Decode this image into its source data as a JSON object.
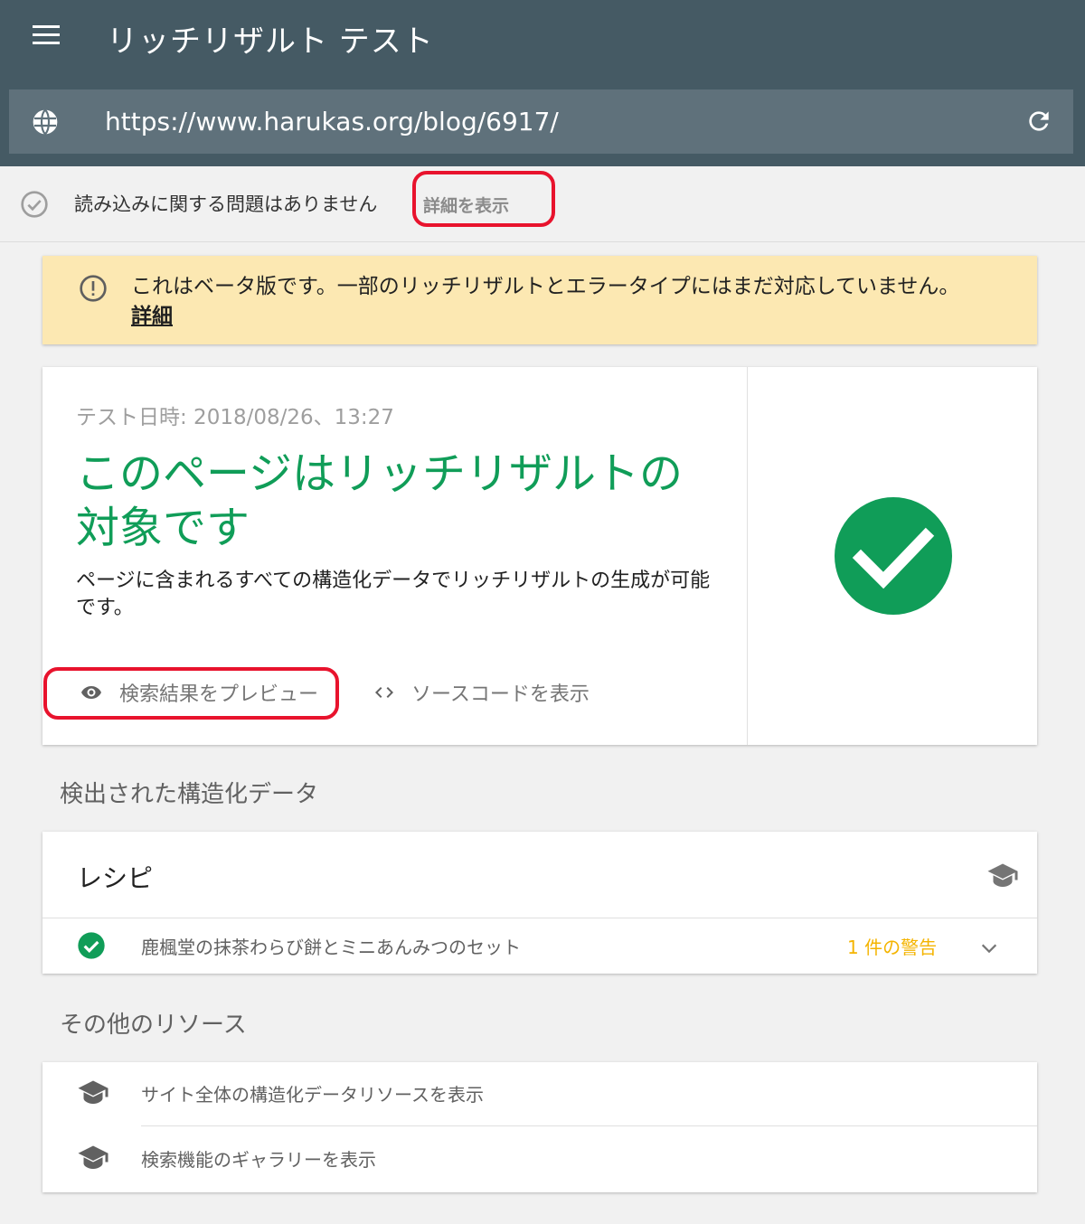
{
  "header": {
    "title": "リッチリザルト テスト",
    "menu_icon": "menu-icon"
  },
  "urlbar": {
    "url": "https://www.harukas.org/blog/6917/",
    "left_icon": "globe-icon",
    "right_icon": "reload-icon"
  },
  "status": {
    "text": "読み込みに関する問題はありません",
    "details_label": "詳細を表示"
  },
  "beta_notice": {
    "text": "これはベータ版です。一部のリッチリザルトとエラータイプにはまだ対応していません。",
    "link_label": "詳細"
  },
  "result": {
    "test_date": "テスト日時: 2018/08/26、13:27",
    "headline": "このページはリッチリザルトの対象です",
    "description": "ページに含まれるすべての構造化データでリッチリザルトの生成が可能です。",
    "preview_label": "検索結果をプレビュー",
    "source_label": "ソースコードを表示"
  },
  "detected": {
    "section_title": "検出された構造化データ",
    "card_title": "レシピ",
    "item_text": "鹿楓堂の抹茶わらび餅とミニあんみつのセット",
    "warning_text": "1 件の警告"
  },
  "resources": {
    "section_title": "その他のリソース",
    "items": [
      {
        "label": "サイト全体の構造化データリソースを表示"
      },
      {
        "label": "検索機能のギャラリーを表示"
      }
    ]
  },
  "colors": {
    "header_bg": "#455a64",
    "urlbar_bg": "#5f717b",
    "success_green": "#109d58",
    "warning_amber": "#f4b400",
    "beta_bg": "#fce8b2",
    "annotation_red": "#e8132d"
  }
}
